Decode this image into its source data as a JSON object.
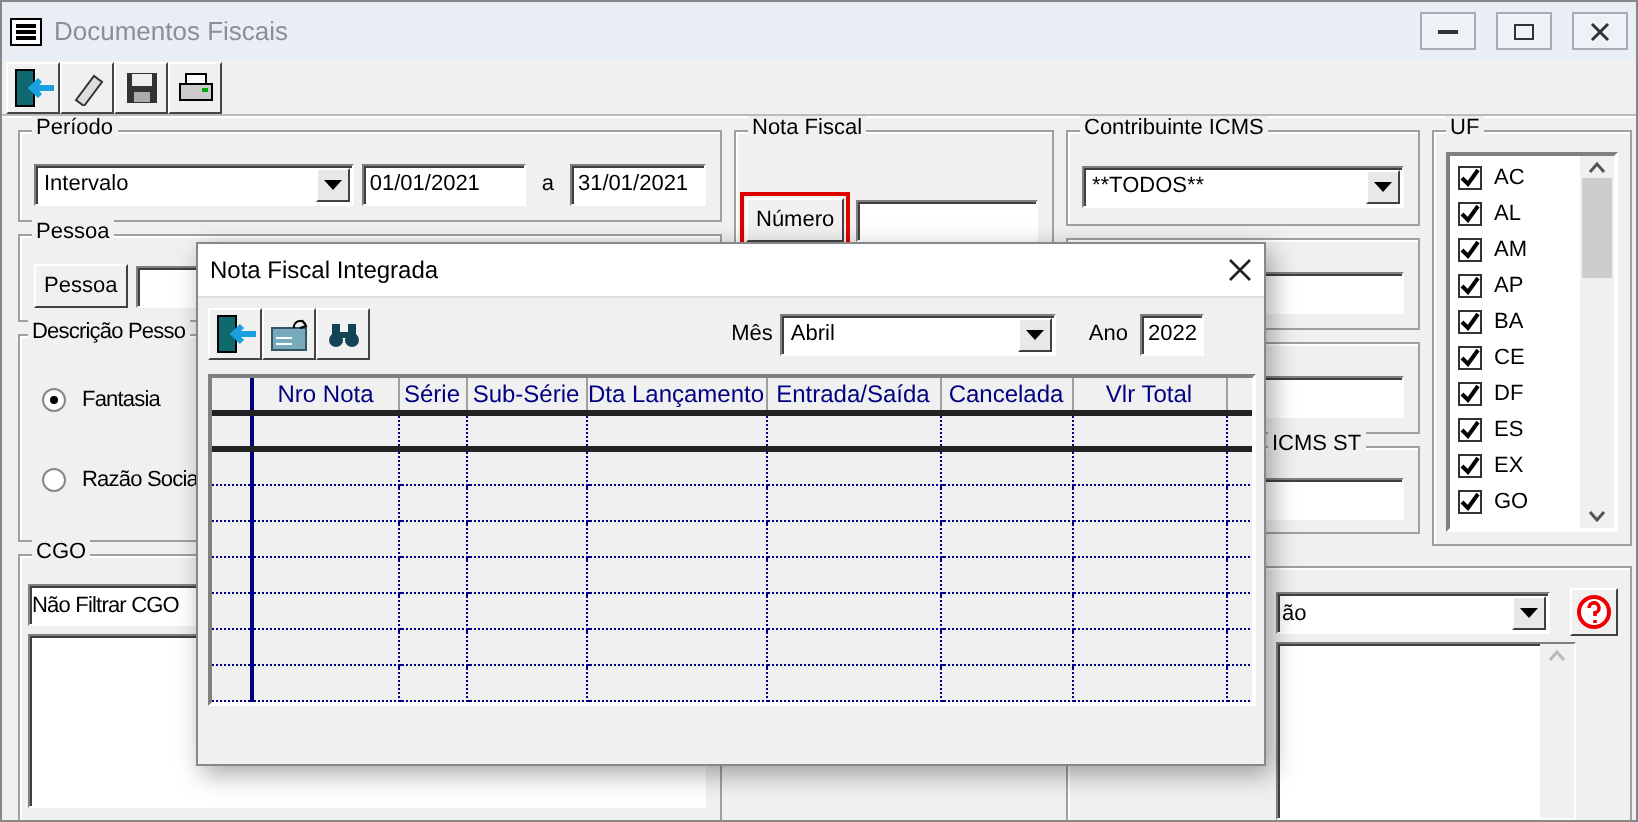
{
  "window": {
    "title": "Documentos Fiscais"
  },
  "periodo": {
    "label": "Período",
    "mode": "Intervalo",
    "from": "01/01/2021",
    "separator": "a",
    "to": "31/01/2021"
  },
  "pessoa": {
    "label": "Pessoa",
    "button": "Pessoa"
  },
  "descricao_pessoa": {
    "label": "Descrição Pesso",
    "options": [
      {
        "label": "Fantasia",
        "selected": true
      },
      {
        "label": "Razão Socia",
        "selected": false
      }
    ]
  },
  "cgo": {
    "label": "CGO",
    "value": "Não Filtrar CGO"
  },
  "nota_fiscal": {
    "label": "Nota Fiscal",
    "button": "Número",
    "highlighted": true
  },
  "contribuinte_icms": {
    "label": "Contribuinte ICMS",
    "value": "**TODOS**"
  },
  "icms_st": {
    "label": "ICMS ST"
  },
  "uf": {
    "label": "UF",
    "items": [
      {
        "label": "AC",
        "checked": true
      },
      {
        "label": "AL",
        "checked": true
      },
      {
        "label": "AM",
        "checked": true
      },
      {
        "label": "AP",
        "checked": true
      },
      {
        "label": "BA",
        "checked": true
      },
      {
        "label": "CE",
        "checked": true
      },
      {
        "label": "DF",
        "checked": true
      },
      {
        "label": "ES",
        "checked": true
      },
      {
        "label": "EX",
        "checked": true
      },
      {
        "label": "GO",
        "checked": true
      }
    ]
  },
  "lower_right": {
    "value": "ão"
  },
  "dialog": {
    "title": "Nota Fiscal Integrada",
    "month_label": "Mês",
    "month": "Abril",
    "year_label": "Ano",
    "year": "2022",
    "columns": [
      "Nro Nota",
      "Série",
      "Sub-Série",
      "Dta Lançamento",
      "Entrada/Saída",
      "Cancelada",
      "Vlr Total"
    ]
  }
}
